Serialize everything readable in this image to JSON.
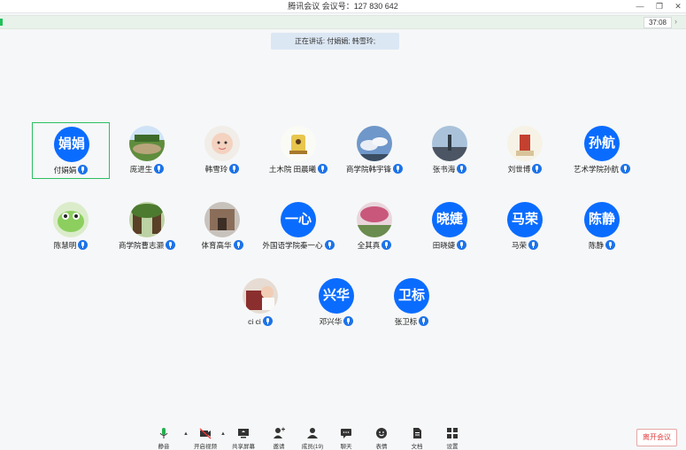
{
  "window": {
    "title": "腾讯会议 会议号：127 830 642",
    "timer": "37:08",
    "controls": [
      "—",
      "❐",
      "✕"
    ]
  },
  "banner": {
    "text": "正在讲话: 付娟娟; 韩雪玲;"
  },
  "participants": [
    {
      "name": "付娟娟",
      "avatar_text": "娟娟",
      "active": true
    },
    {
      "name": "庞进生"
    },
    {
      "name": "韩雪玲"
    },
    {
      "name": "土木院 田晨曦"
    },
    {
      "name": "商学院韩宇锋"
    },
    {
      "name": "张书海"
    },
    {
      "name": "刘世博"
    },
    {
      "name": "艺术学院孙航",
      "avatar_text": "孙航"
    },
    {
      "name": "陈慧明"
    },
    {
      "name": "商学院曹志灏"
    },
    {
      "name": "体育高华"
    },
    {
      "name": "外国语学院秦一心",
      "avatar_text": "一心"
    },
    {
      "name": "全其真"
    },
    {
      "name": "田晓婕",
      "avatar_text": "晓婕"
    },
    {
      "name": "马荣",
      "avatar_text": "马荣"
    },
    {
      "name": "陈静",
      "avatar_text": "陈静"
    },
    {
      "name": "ci ci"
    },
    {
      "name": "邓兴华",
      "avatar_text": "兴华"
    },
    {
      "name": "张卫标",
      "avatar_text": "卫标"
    }
  ],
  "toolbar": {
    "mute": "静音",
    "video": "开启视频",
    "share": "共享屏幕",
    "invite": "邀请",
    "members": "成员(19)",
    "chat": "聊天",
    "emoji": "表情",
    "docs": "文档",
    "settings": "设置",
    "leave": "离开会议"
  },
  "colors": {
    "accent": "#0a6cff",
    "active_border": "#2bbf62",
    "leave": "#e04040"
  }
}
